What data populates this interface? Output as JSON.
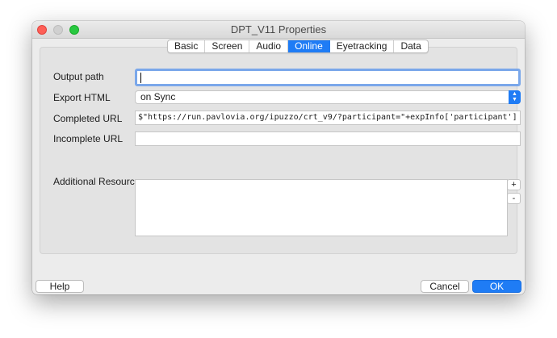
{
  "window": {
    "title": "DPT_V11 Properties"
  },
  "tabs": [
    {
      "label": "Basic"
    },
    {
      "label": "Screen"
    },
    {
      "label": "Audio"
    },
    {
      "label": "Online",
      "active": true
    },
    {
      "label": "Eyetracking"
    },
    {
      "label": "Data"
    }
  ],
  "form": {
    "output_path": {
      "label": "Output path",
      "value": ""
    },
    "export_html": {
      "label": "Export HTML",
      "value": "on Sync"
    },
    "completed_url": {
      "label": "Completed URL",
      "value": "$\"https://run.pavlovia.org/ipuzzo/crt_v9/?participant=\"+expInfo['participant']"
    },
    "incomplete_url": {
      "label": "Incomplete URL",
      "value": ""
    },
    "additional_resources": {
      "label": "Additional Resources",
      "add_label": "+",
      "remove_label": "-"
    }
  },
  "buttons": {
    "help": "Help",
    "cancel": "Cancel",
    "ok": "OK"
  },
  "colors": {
    "accent": "#1f7cf5",
    "close": "#fe5f57",
    "zoom": "#28c840"
  }
}
